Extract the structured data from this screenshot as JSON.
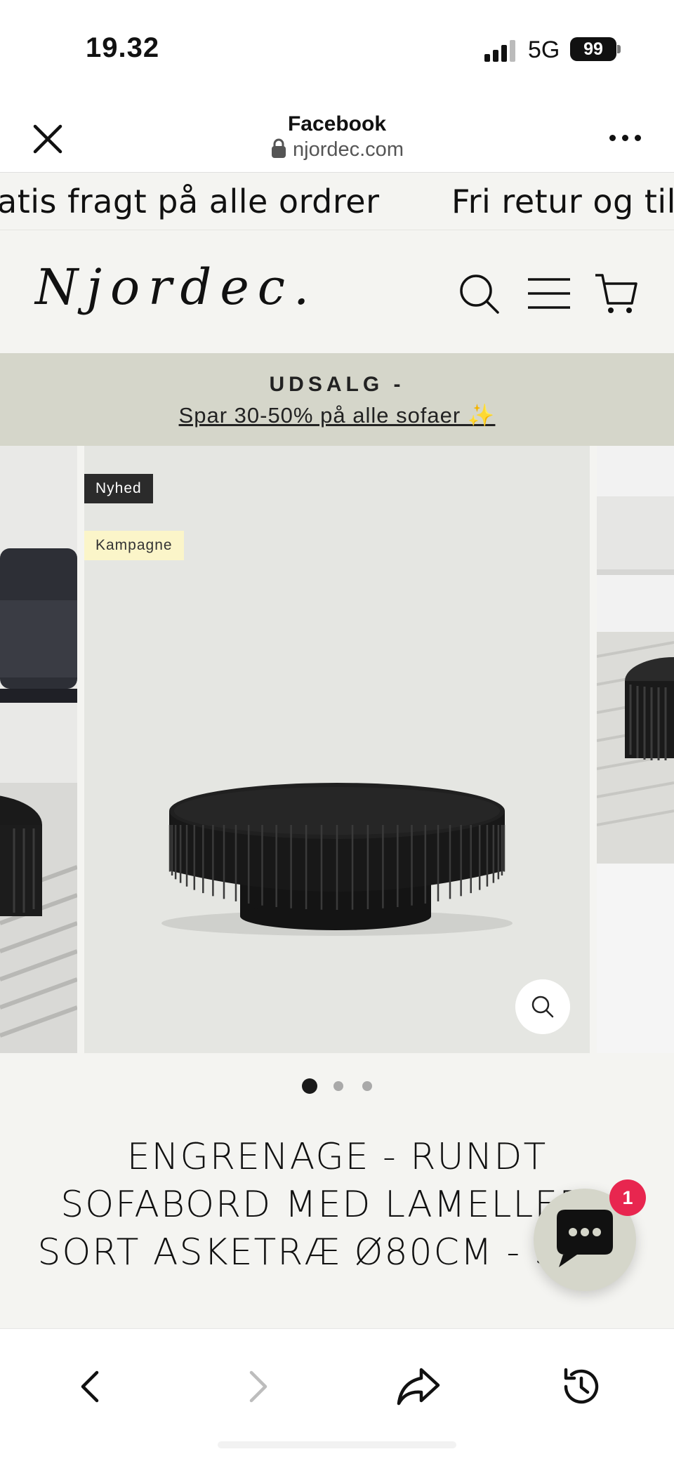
{
  "status_bar": {
    "time": "19.32",
    "network": "5G",
    "battery": "99"
  },
  "browser": {
    "site_name": "Facebook",
    "url": "njordec.com"
  },
  "announcements": [
    "atis fragt på alle ordrer",
    "Fri retur og tilt"
  ],
  "store": {
    "logo": "Njordec."
  },
  "sale_banner": {
    "title": "UDSALG -",
    "subtitle": "Spar 30-50% på alle sofaer ✨"
  },
  "gallery": {
    "badges": {
      "new": "Nyhed",
      "campaign": "Kampagne"
    },
    "slide_count": 3,
    "active_slide": 1
  },
  "product": {
    "title": "ENGRENAGE - RUNDT SOFABORD MED LAMELLER - SORT ASKETRÆ Ø80CM - SORT"
  },
  "chat": {
    "unread_count": "1"
  },
  "colors": {
    "sale_bar": "#d5d6ca",
    "header_bg": "#f4f4f1",
    "badge_new": "#2b2b2b",
    "badge_campaign": "#fbf5c9",
    "chat_badge": "#e8264f"
  }
}
